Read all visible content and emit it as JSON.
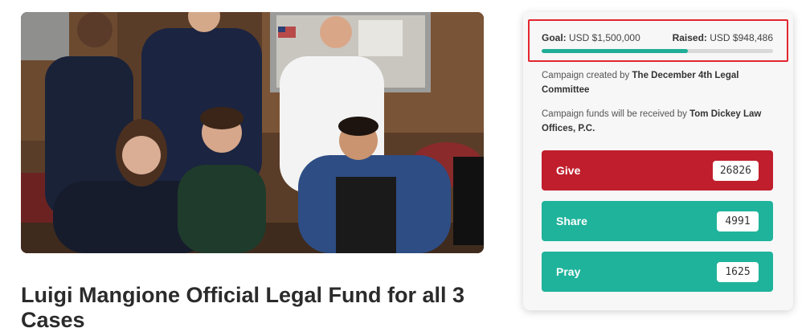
{
  "campaign": {
    "title": "Luigi Mangione Official Legal Fund for all 3 Cases",
    "goal_label": "Goal:",
    "goal_value": "USD $1,500,000",
    "raised_label": "Raised:",
    "raised_value": "USD $948,486",
    "progress_fraction": 0.632,
    "created_prefix": "Campaign created by",
    "created_by": "The December 4th Legal Committee",
    "funds_prefix": "Campaign funds will be received by",
    "funds_recipient": "Tom Dickey Law Offices, P.C."
  },
  "actions": {
    "give": {
      "label": "Give",
      "count": "26826",
      "color": "#c01e2c"
    },
    "share": {
      "label": "Share",
      "count": "4991",
      "color": "#1fb39b"
    },
    "pray": {
      "label": "Pray",
      "count": "1625",
      "color": "#1fb39b"
    }
  },
  "colors": {
    "highlight_border": "#e3262f",
    "progress": "#1fae98"
  }
}
